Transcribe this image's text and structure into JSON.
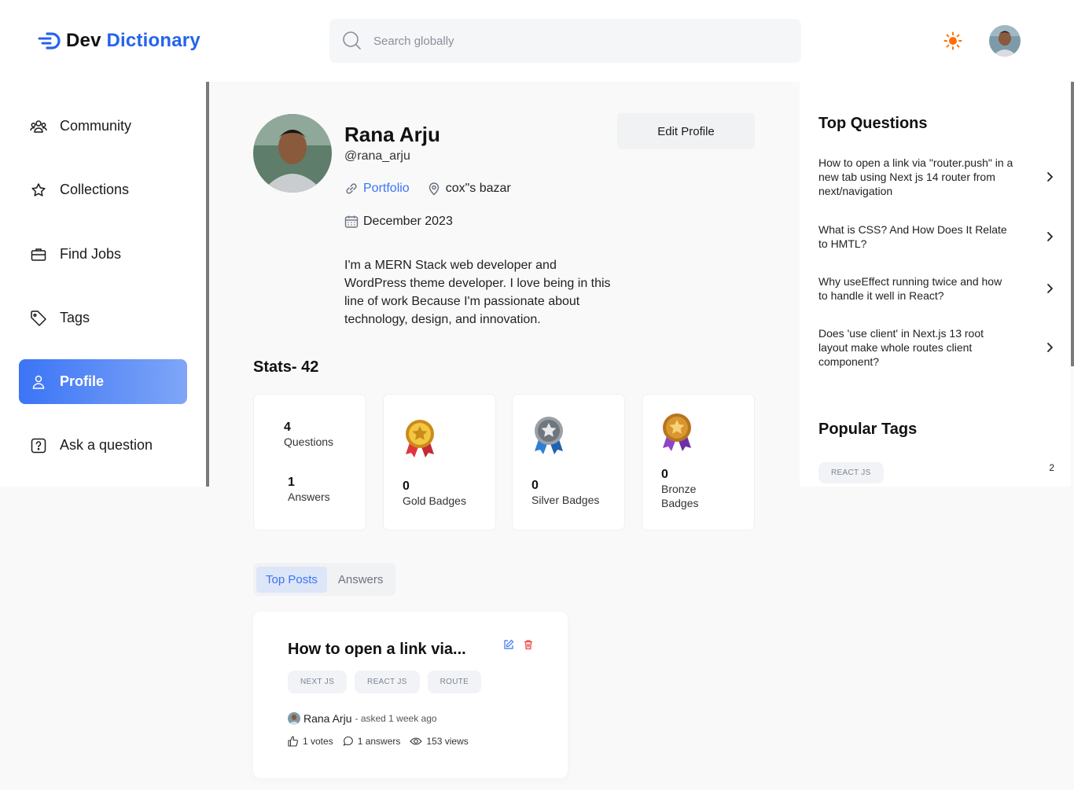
{
  "header": {
    "logo_dev": "Dev",
    "logo_dictionary": "Dictionary",
    "search_placeholder": "Search globally"
  },
  "sidebar": {
    "items": [
      {
        "label": "Community",
        "icon": "community-icon"
      },
      {
        "label": "Collections",
        "icon": "star-icon"
      },
      {
        "label": "Find Jobs",
        "icon": "briefcase-icon"
      },
      {
        "label": "Tags",
        "icon": "tag-icon"
      },
      {
        "label": "Profile",
        "icon": "user-icon",
        "active": true
      },
      {
        "label": "Ask a question",
        "icon": "question-icon"
      }
    ]
  },
  "profile": {
    "name": "Rana Arju",
    "username": "@rana_arju",
    "portfolio_label": "Portfolio",
    "location": "cox\"s bazar",
    "joined": "December 2023",
    "bio": "I'm a MERN Stack web developer and WordPress theme developer. I love being in this line of work Because I'm passionate about technology, design, and innovation.",
    "edit_label": "Edit Profile"
  },
  "stats": {
    "title": "Stats- 42",
    "questions_count": "4",
    "questions_label": "Questions",
    "answers_count": "1",
    "answers_label": "Answers",
    "gold_count": "0",
    "gold_label": "Gold Badges",
    "silver_count": "0",
    "silver_label": "Silver Badges",
    "bronze_count": "0",
    "bronze_label": "Bronze Badges"
  },
  "tabs": [
    {
      "label": "Top Posts",
      "active": true
    },
    {
      "label": "Answers",
      "active": false
    }
  ],
  "post": {
    "title": "How to open a link via...",
    "tags": [
      "NEXT JS",
      "REACT JS",
      "ROUTE"
    ],
    "author": "Rana Arju",
    "asked": "- asked 1 week ago",
    "votes": "1 votes",
    "answers": "1 answers",
    "views": "153 views"
  },
  "right": {
    "top_questions_title": "Top Questions",
    "questions": [
      "How to open a link via \"router.push\" in a new tab using Next js 14 router from next/navigation",
      "What is CSS? And How Does It Relate to HMTL?",
      "Why useEffect running twice and how to handle it well in React?",
      "Does 'use client' in Next.js 13 root layout make whole routes client component?"
    ],
    "popular_tags_title": "Popular Tags",
    "tags": [
      {
        "name": "REACT JS",
        "count": "2"
      }
    ]
  },
  "colors": {
    "accent": "#3b74f5",
    "accent_light": "#7fa6f7",
    "sun": "#ff7000",
    "delete": "#ef4444"
  }
}
